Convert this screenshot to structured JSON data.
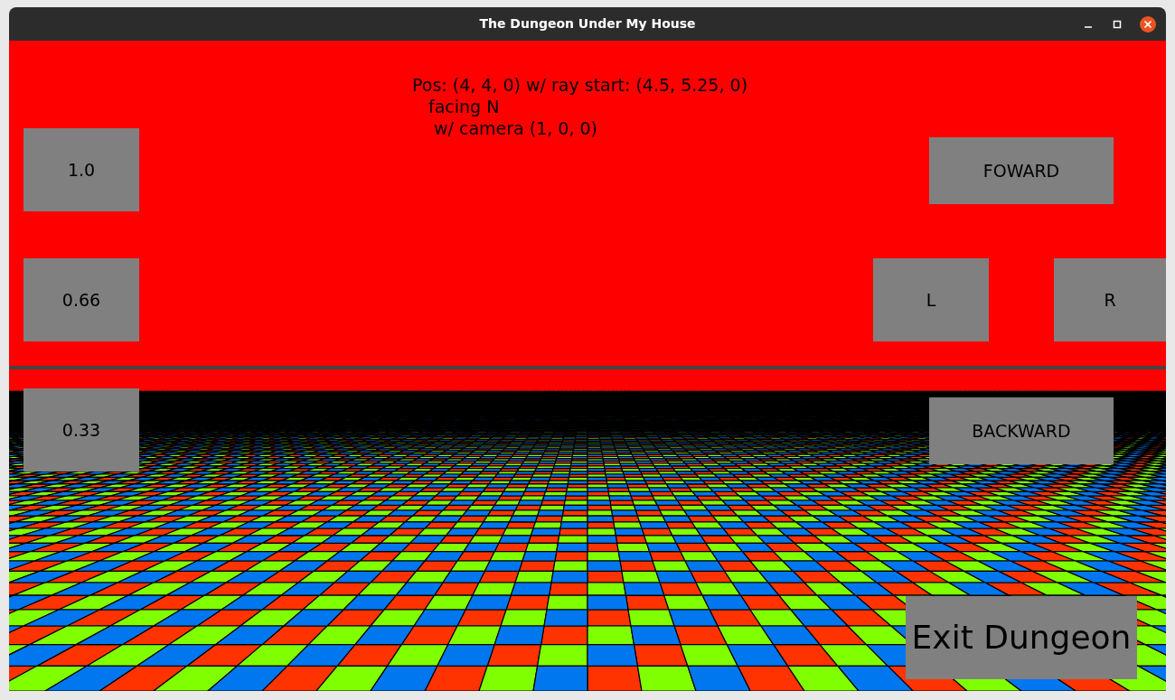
{
  "window": {
    "title": "The Dungeon Under My House"
  },
  "status_lines": [
    "Pos: (4, 4, 0) w/ ray start: (4.5, 5.25, 0)",
    "facing N",
    "w/ camera (1, 0, 0)"
  ],
  "buttons": [
    {
      "label": "1.0"
    },
    {
      "label": "0.66"
    },
    {
      "label": "0.33"
    },
    {
      "label": "FOWARD"
    },
    {
      "label": "L"
    },
    {
      "label": "R"
    },
    {
      "label": "BACKWARD"
    },
    {
      "label": "Exit Dungeon"
    }
  ]
}
